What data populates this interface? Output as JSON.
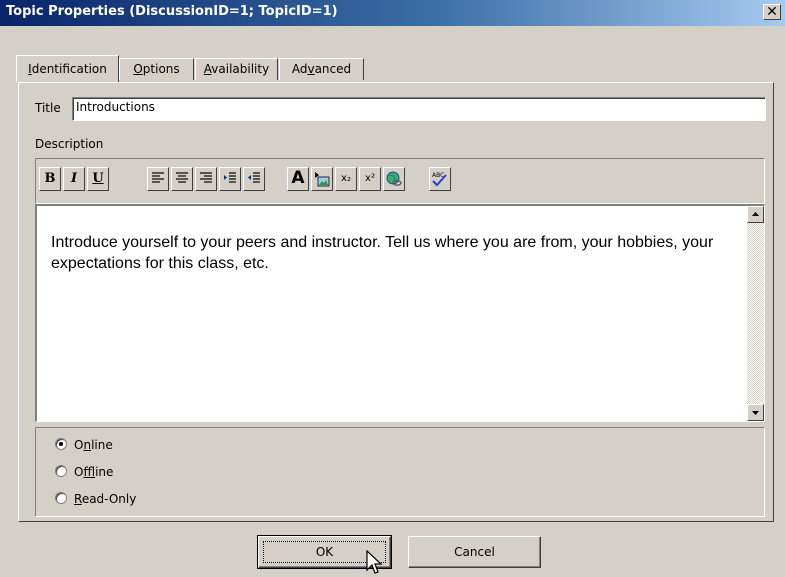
{
  "window": {
    "title": "Topic Properties (DiscussionID=1; TopicID=1)",
    "close": "✕"
  },
  "tabs": [
    {
      "label": "Identification",
      "accel": "I",
      "rest": "dentification",
      "active": true
    },
    {
      "label": "Options",
      "accel": "O",
      "rest": "ptions",
      "active": false
    },
    {
      "label": "Availability",
      "accel": "A",
      "rest": "vailability",
      "active": false
    },
    {
      "label": "Advanced",
      "pre": "Ad",
      "accel": "v",
      "rest": "anced",
      "active": false
    }
  ],
  "form": {
    "title_label": "Title",
    "title_value": "Introductions",
    "description_label": "Description",
    "description_text": "Introduce yourself to your peers and instructor.  Tell us where you are from, your hobbies, your expectations for this class, etc."
  },
  "toolbar": {
    "bold": "B",
    "italic": "I",
    "underline": "U",
    "font": "A",
    "subscript": "x₂",
    "superscript": "x²",
    "spell": "ABC"
  },
  "status": {
    "options": [
      {
        "label": "Online",
        "pre": "O",
        "accel": "n",
        "rest": "line",
        "selected": true
      },
      {
        "label": "Offline",
        "pre": "O",
        "accel": "f",
        "rest": "fline",
        "selected": false
      },
      {
        "label": "Read-Only",
        "pre": "",
        "accel": "R",
        "rest": "ead-Only",
        "selected": false
      }
    ]
  },
  "buttons": {
    "ok": "OK",
    "cancel": "Cancel"
  },
  "colors": {
    "titlebar_start": "#0a246a",
    "titlebar_end": "#a6caf0",
    "face": "#d4d0c8"
  }
}
